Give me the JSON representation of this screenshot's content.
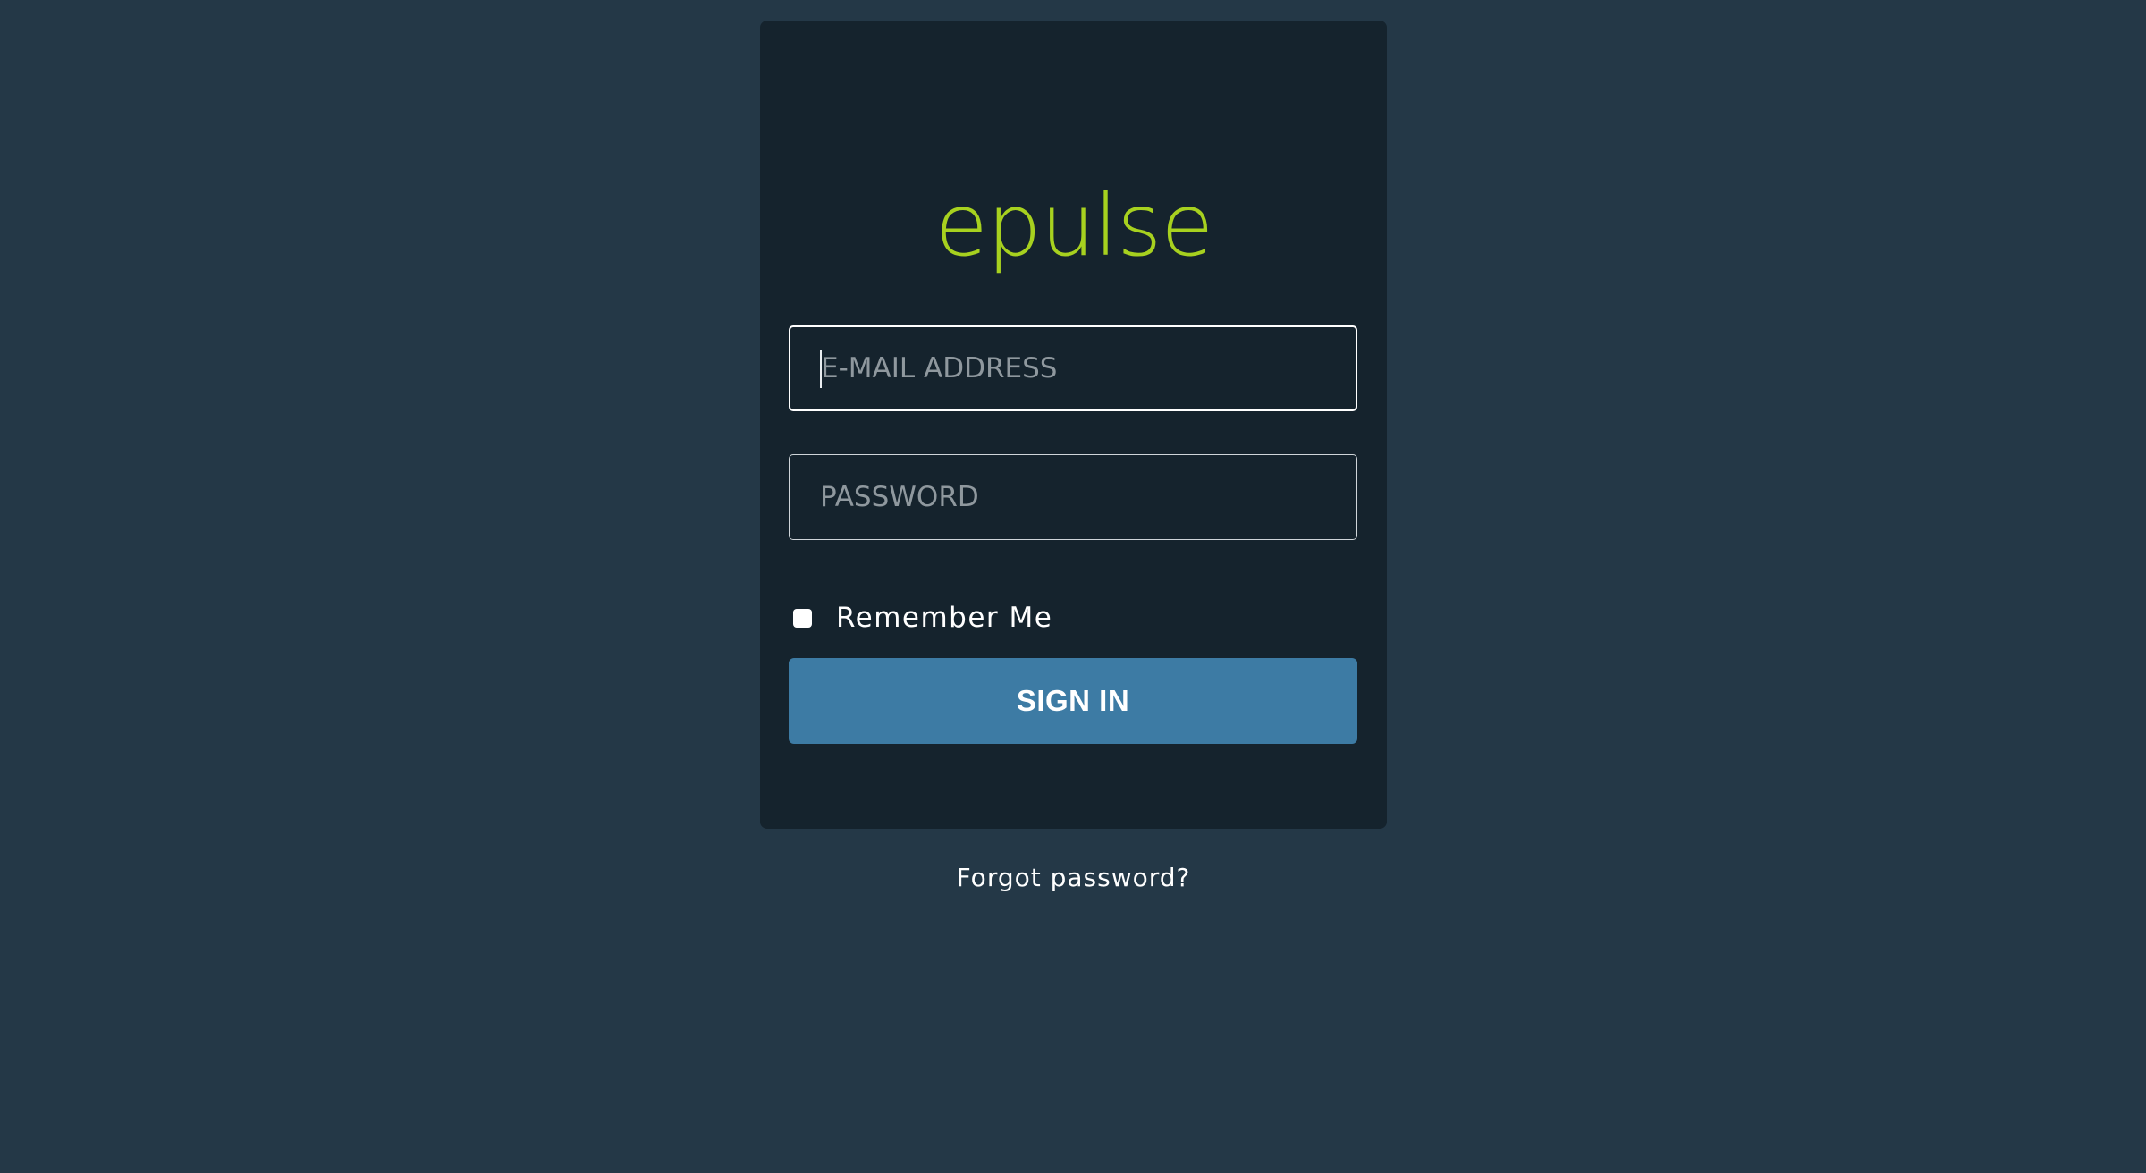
{
  "brand": {
    "name": "epulse",
    "color": "#a7d11f"
  },
  "colors": {
    "background": "#243847",
    "card": "#15232d",
    "button": "#3d7ba4"
  },
  "form": {
    "email": {
      "placeholder": "E-MAIL ADDRESS",
      "value": ""
    },
    "password": {
      "placeholder": "PASSWORD",
      "value": ""
    },
    "remember_me": {
      "label": "Remember Me",
      "checked": false
    },
    "submit_label": "SIGN IN"
  },
  "links": {
    "forgot_password": "Forgot password?"
  }
}
